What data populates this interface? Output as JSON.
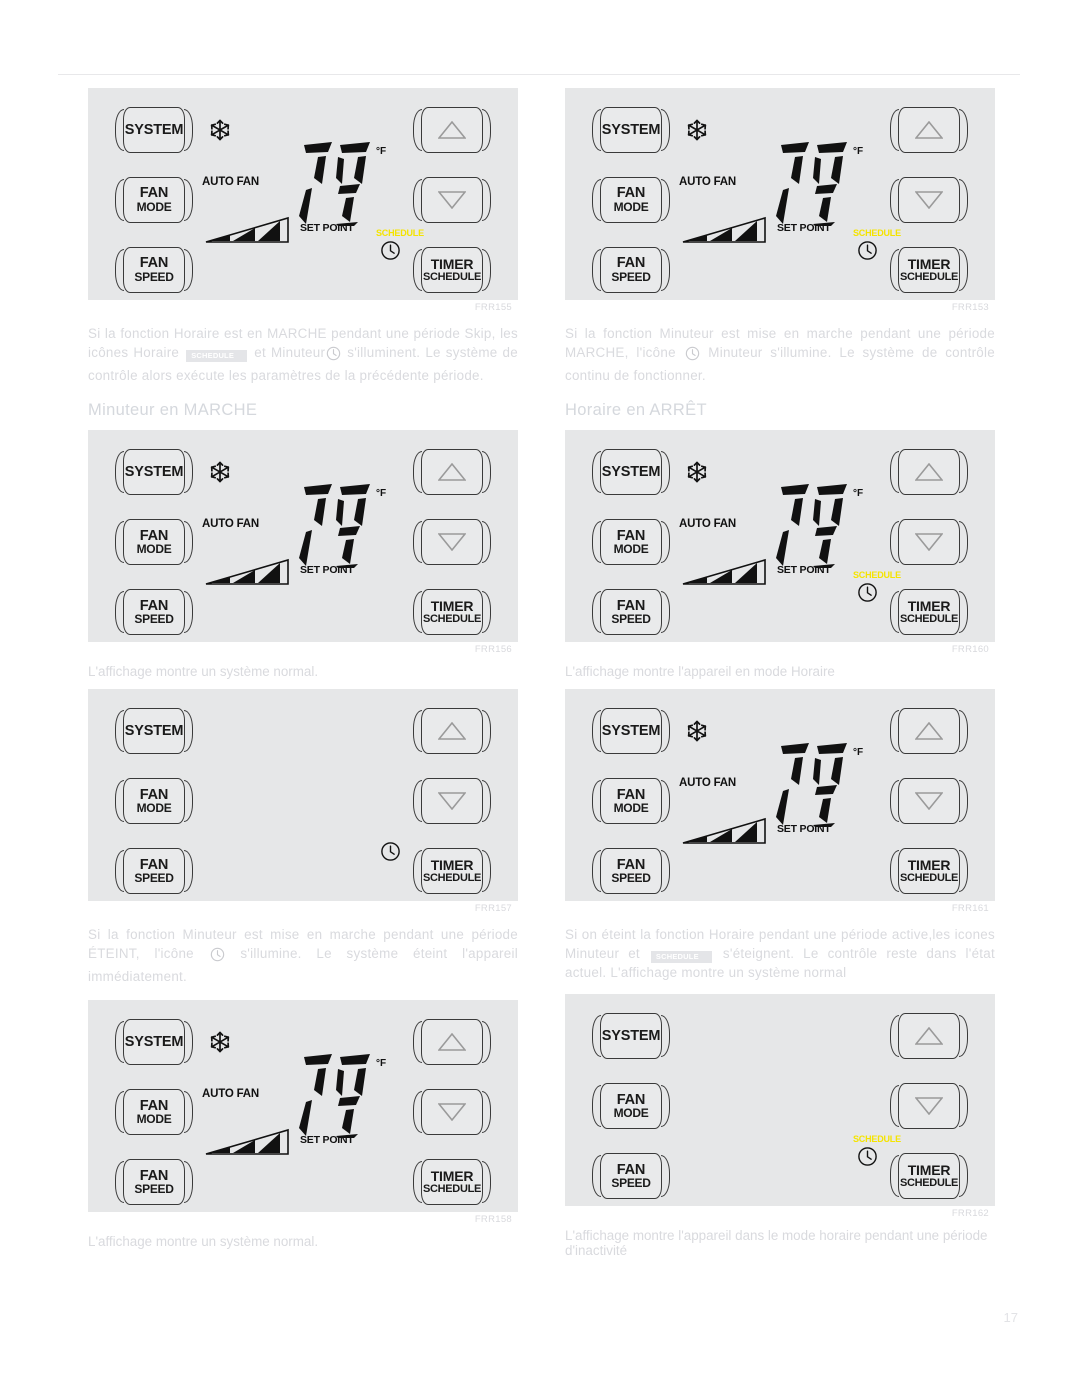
{
  "document": {
    "page_number": "17",
    "language": "fr"
  },
  "panel_labels": {
    "system": "SYSTEM",
    "fan": "FAN",
    "mode": "MODE",
    "speed": "SPEED",
    "timer": "TIMER",
    "schedule": "SCHEDULE",
    "auto_fan": "AUTO FAN",
    "set_point": "SET POINT",
    "degree_unit": "°F",
    "temperature": "79",
    "schedule_indicator": "SCHEDULE",
    "up_arrow_icon": "triangle-up-icon",
    "down_arrow_icon": "triangle-down-icon",
    "snowflake_icon": "snowflake-icon",
    "clock_icon": "clock-icon",
    "fan_speed_icon": "fan-speed-wedge-icon"
  },
  "colors": {
    "panel_background": "#e6e7e8",
    "schedule_yellow": "#f5e400",
    "text_gray": "#d9dade",
    "button_outline": "#3a3a3a"
  },
  "left_column": {
    "figure_1": {
      "code": "FRR155",
      "display_on": true,
      "schedule_lit": true,
      "clock_shown": true
    },
    "paragraph_1": {
      "part_a": "Si la fonction Horaire est en MARCHE pendant une période Skip, les icônes Horaire",
      "badge": "SCHEDULE",
      "part_b": "et Minuteur",
      "part_c": "s'illuminent. Le système de contrôle alors exécute les paramètres de la précédente période."
    },
    "heading_1": "Minuteur en MARCHE",
    "figure_2": {
      "code": "FRR156",
      "display_on": true,
      "schedule_lit": false,
      "clock_shown": false
    },
    "caption_2": "L'affichage montre un système normal.",
    "figure_3": {
      "code": "FRR157",
      "display_on": false,
      "schedule_lit": false,
      "clock_shown": true
    },
    "paragraph_2": {
      "part_a": "Si la fonction Minuteur est mise en marche pendant une période ÉTEINT, l'icône",
      "part_b": "s'illumine. Le système éteint l'appareil immédiatement."
    },
    "figure_4": {
      "code": "FRR158",
      "display_on": true,
      "schedule_lit": false,
      "clock_shown": false
    },
    "caption_4": "L'affichage montre un système normal."
  },
  "right_column": {
    "figure_1": {
      "code": "FRR153",
      "display_on": true,
      "schedule_lit": true,
      "clock_shown": true
    },
    "paragraph_1": {
      "part_a": "Si la fonction Minuteur est mise en marche pendant une période MARCHE, l'icône",
      "part_b": "Minuteur s'illumine. Le système de contrôle continu de fonctionner."
    },
    "heading_1": "Horaire en ARRÊT",
    "figure_2": {
      "code": "FRR160",
      "display_on": true,
      "schedule_lit": true,
      "clock_shown": true
    },
    "caption_2": "L'affichage montre l'appareil en mode Horaire",
    "figure_3": {
      "code": "FRR161",
      "display_on": true,
      "schedule_lit": false,
      "clock_shown": false
    },
    "paragraph_2": {
      "part_a": "Si on éteint la fonction Horaire pendant une période active,les icones Minuteur et",
      "badge": "SCHEDULE",
      "part_b": "s'éteignent. Le contrôle reste dans l'état actuel. L'affichage montre un système normal"
    },
    "figure_4": {
      "code": "FRR162",
      "display_on": false,
      "schedule_lit": true,
      "clock_shown": true
    },
    "caption_4": "L'affichage montre l'appareil dans le mode horaire pendant une période d'inactivité"
  }
}
